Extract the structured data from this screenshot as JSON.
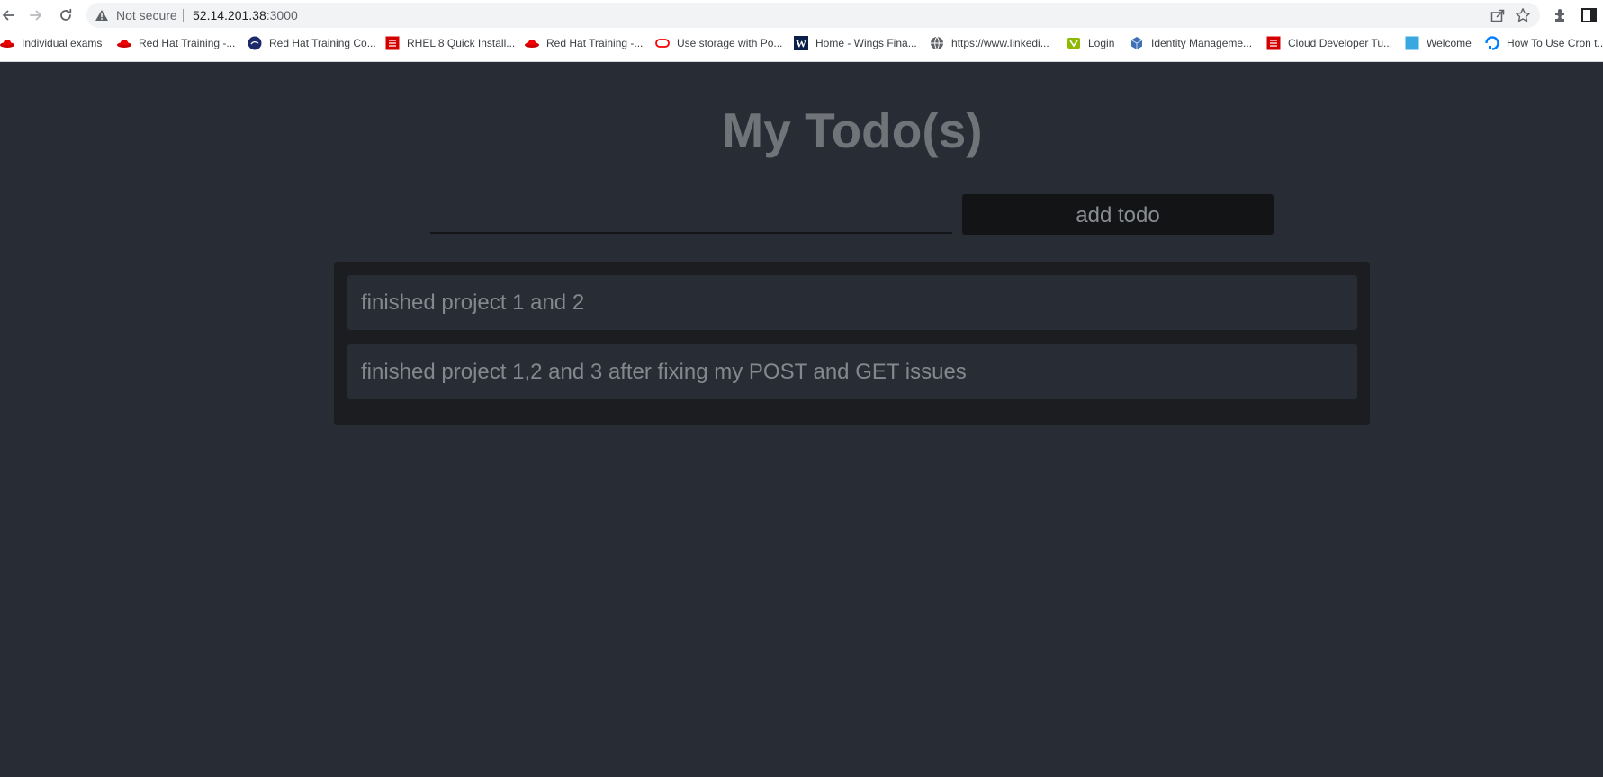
{
  "browser": {
    "security_label": "Not secure",
    "url_host": "52.14.201.38",
    "url_port": ":3000",
    "icons": {
      "back": "back-arrow-icon",
      "forward": "forward-arrow-icon",
      "reload": "reload-icon",
      "warning": "warning-icon",
      "share": "share-icon",
      "star": "star-icon",
      "extensions": "puzzle-icon",
      "side_panel": "side-panel-icon"
    }
  },
  "bookmarks": [
    {
      "label": "Individual exams",
      "icon": "redhat-icon"
    },
    {
      "label": "Red Hat Training -...",
      "icon": "redhat-icon"
    },
    {
      "label": "Red Hat Training Co...",
      "icon": "circle-logo-icon"
    },
    {
      "label": "RHEL 8 Quick Install...",
      "icon": "red-square-icon"
    },
    {
      "label": "Red Hat Training -...",
      "icon": "redhat-icon"
    },
    {
      "label": "Use storage with Po...",
      "icon": "oracle-icon"
    },
    {
      "label": "Home - Wings Fina...",
      "icon": "w-logo-icon"
    },
    {
      "label": "https://www.linkedi...",
      "icon": "globe-icon"
    },
    {
      "label": "Login",
      "icon": "vagrant-icon"
    },
    {
      "label": "Identity Manageme...",
      "icon": "cube-icon"
    },
    {
      "label": "Cloud Developer Tu...",
      "icon": "red-square-icon"
    },
    {
      "label": "Welcome",
      "icon": "blue-square-icon"
    },
    {
      "label": "How To Use Cron t...",
      "icon": "digitalocean-icon"
    }
  ],
  "app": {
    "title": "My Todo(s)",
    "input_value": "",
    "add_button_label": "add todo",
    "todos": [
      {
        "text": "finished project 1 and 2"
      },
      {
        "text": "finished project 1,2 and 3 after fixing my POST and GET issues"
      }
    ]
  },
  "colors": {
    "page_background": "#282c34",
    "list_panel": "#1b1d21",
    "button_background": "#131416",
    "title_text": "#707479",
    "todo_text": "#84888e"
  }
}
